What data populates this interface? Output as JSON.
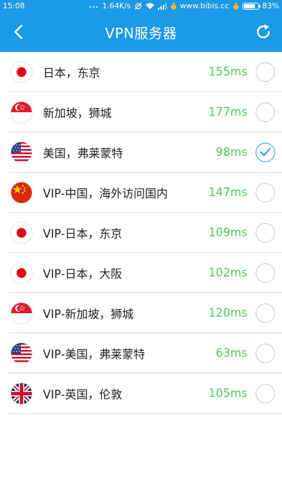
{
  "status_bar": {
    "time": "15:08",
    "dots": "...",
    "speed": "1.64K/s",
    "notice": "www.bibis.cc",
    "battery": "83%",
    "battery_level": 0.83
  },
  "header": {
    "title": "VPN服务器"
  },
  "colors": {
    "accent": "#1a9ae8",
    "latency": "#4ccb58",
    "divider": "#dcdcdc"
  },
  "servers": [
    {
      "name": "日本，东京",
      "latency": "155ms",
      "flag": "japan-flag-icon",
      "selected": false
    },
    {
      "name": "新加坡，狮城",
      "latency": "177ms",
      "flag": "singapore-flag-icon",
      "selected": false
    },
    {
      "name": "美国，弗莱蒙特",
      "latency": "98ms",
      "flag": "usa-flag-icon",
      "selected": true
    },
    {
      "name": "VIP-中国，海外访问国内",
      "latency": "147ms",
      "flag": "china-flag-icon",
      "selected": false
    },
    {
      "name": "VIP-日本，东京",
      "latency": "109ms",
      "flag": "japan-flag-icon",
      "selected": false
    },
    {
      "name": "VIP-日本，大阪",
      "latency": "102ms",
      "flag": "japan-flag-icon",
      "selected": false
    },
    {
      "name": "VIP-新加坡，狮城",
      "latency": "120ms",
      "flag": "singapore-flag-icon",
      "selected": false
    },
    {
      "name": "VIP-美国，弗莱蒙特",
      "latency": "63ms",
      "flag": "usa-flag-icon",
      "selected": false
    },
    {
      "name": "VIP-英国，伦敦",
      "latency": "105ms",
      "flag": "uk-flag-icon",
      "selected": false
    }
  ]
}
